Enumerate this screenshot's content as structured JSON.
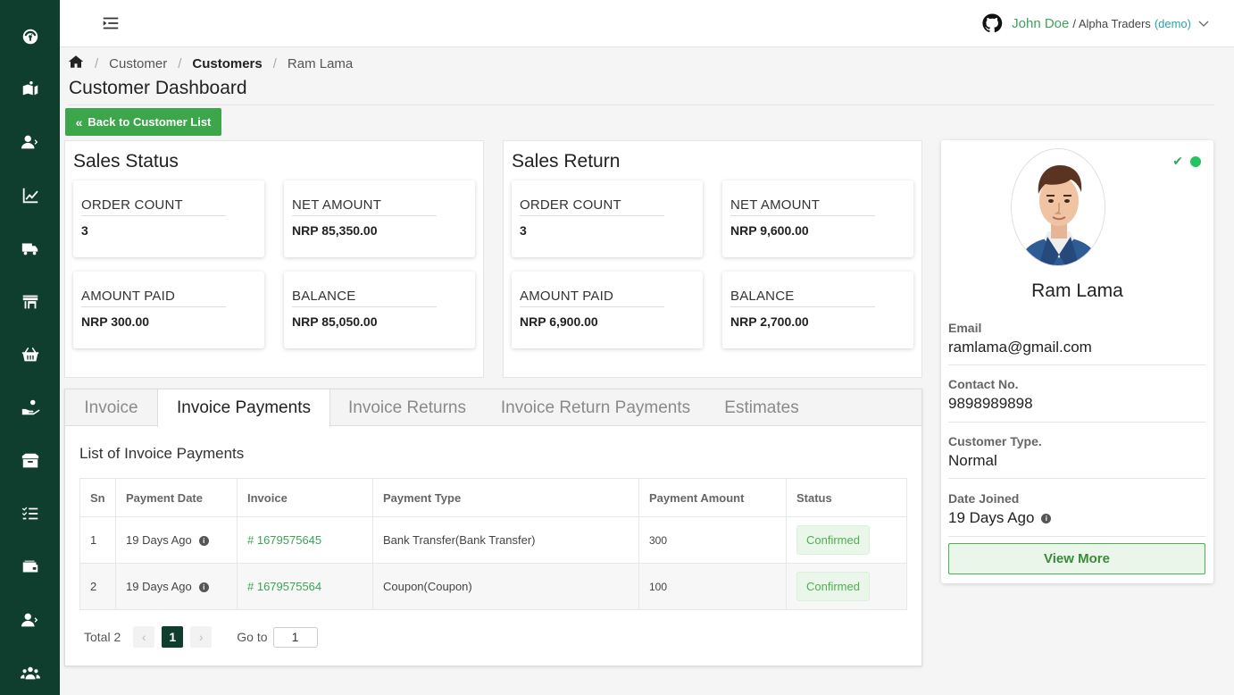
{
  "topbar": {
    "user_name": "John Doe",
    "org_sep": "/ Alpha Traders",
    "demo": "(demo)"
  },
  "breadcrumb": {
    "level1": "Customer",
    "level2": "Customers",
    "level3": "Ram Lama"
  },
  "page_title": "Customer Dashboard",
  "back_button": "Back to Customer List",
  "sales_status": {
    "title": "Sales Status",
    "order_count_label": "ORDER COUNT",
    "order_count": "3",
    "net_amount_label": "NET AMOUNT",
    "net_amount": "NRP 85,350.00",
    "amount_paid_label": "AMOUNT PAID",
    "amount_paid": "NRP 300.00",
    "balance_label": "BALANCE",
    "balance": "NRP 85,050.00"
  },
  "sales_return": {
    "title": "Sales Return",
    "order_count_label": "ORDER COUNT",
    "order_count": "3",
    "net_amount_label": "NET AMOUNT",
    "net_amount": "NRP 9,600.00",
    "amount_paid_label": "AMOUNT PAID",
    "amount_paid": "NRP 6,900.00",
    "balance_label": "BALANCE",
    "balance": "NRP 2,700.00"
  },
  "tabs": [
    "Invoice",
    "Invoice Payments",
    "Invoice Returns",
    "Invoice Return Payments",
    "Estimates"
  ],
  "active_tab": "Invoice Payments",
  "list_title": "List of Invoice Payments",
  "table": {
    "headers": [
      "Sn",
      "Payment Date",
      "Invoice",
      "Payment Type",
      "Payment Amount",
      "Status"
    ],
    "rows": [
      {
        "sn": "1",
        "date": "19 Days Ago",
        "invoice": "# 1679575645",
        "type": "Bank Transfer(Bank Transfer)",
        "amount": "300",
        "status": "Confirmed"
      },
      {
        "sn": "2",
        "date": "19 Days Ago",
        "invoice": "# 1679575564",
        "type": "Coupon(Coupon)",
        "amount": "100",
        "status": "Confirmed"
      }
    ]
  },
  "pager": {
    "total": "Total 2",
    "prev": "‹",
    "current": "1",
    "next": "›",
    "goto_label": "Go to",
    "goto_value": "1"
  },
  "profile": {
    "name": "Ram Lama",
    "email_label": "Email",
    "email": "ramlama@gmail.com",
    "contact_label": "Contact No.",
    "contact": "9898989898",
    "type_label": "Customer Type.",
    "type": "Normal",
    "joined_label": "Date Joined",
    "joined": "19 Days Ago",
    "view_more": "View More"
  },
  "colors": {
    "sidebar": "#0f3d2e",
    "accent": "#3ba64a",
    "status_online": "#22c55e"
  },
  "sidebar_icons": [
    "dashboard-icon",
    "book-icon",
    "user-icon",
    "chart-icon",
    "truck-icon",
    "store-icon",
    "basket-icon",
    "hand-coin-icon",
    "box-icon",
    "checklist-icon",
    "wallet-icon",
    "user-settings-icon",
    "team-icon"
  ]
}
